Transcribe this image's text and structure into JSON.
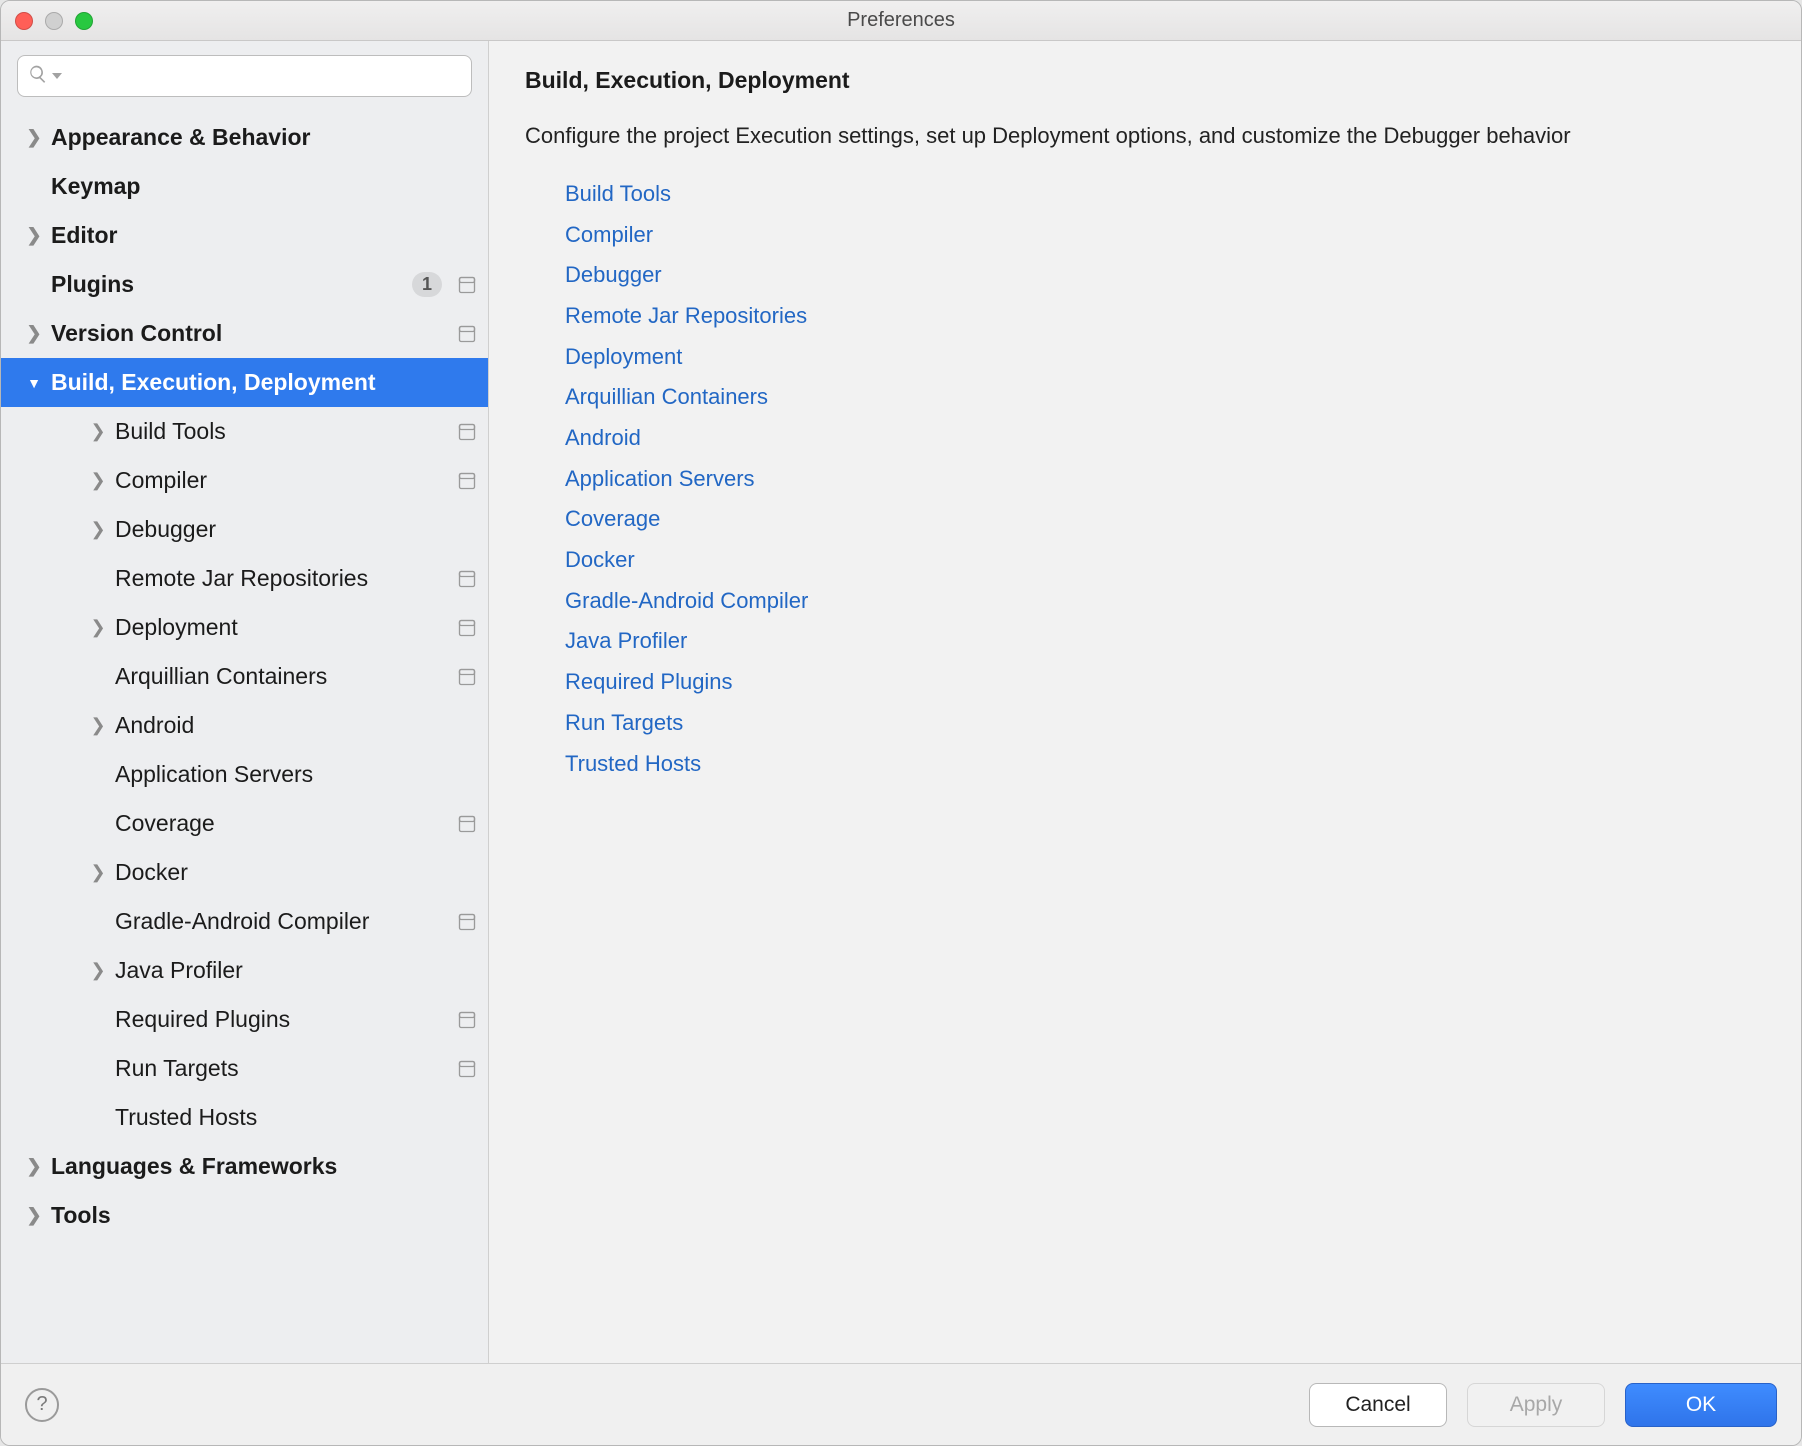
{
  "window": {
    "title": "Preferences"
  },
  "sidebar": {
    "search_placeholder": "",
    "items": [
      {
        "label": "Appearance & Behavior",
        "arrow": "right",
        "top": true
      },
      {
        "label": "Keymap",
        "arrow": "",
        "top": true
      },
      {
        "label": "Editor",
        "arrow": "right",
        "top": true
      },
      {
        "label": "Plugins",
        "arrow": "",
        "top": true,
        "badge": "1",
        "proj": true
      },
      {
        "label": "Version Control",
        "arrow": "right",
        "top": true,
        "proj": true
      },
      {
        "label": "Build, Execution, Deployment",
        "arrow": "down",
        "top": true,
        "selected": true
      },
      {
        "label": "Build Tools",
        "arrow": "right",
        "child": true,
        "proj": true
      },
      {
        "label": "Compiler",
        "arrow": "right",
        "child": true,
        "proj": true
      },
      {
        "label": "Debugger",
        "arrow": "right",
        "child": true
      },
      {
        "label": "Remote Jar Repositories",
        "arrow": "",
        "child": true,
        "proj": true
      },
      {
        "label": "Deployment",
        "arrow": "right",
        "child": true,
        "proj": true
      },
      {
        "label": "Arquillian Containers",
        "arrow": "",
        "child": true,
        "proj": true
      },
      {
        "label": "Android",
        "arrow": "right",
        "child": true
      },
      {
        "label": "Application Servers",
        "arrow": "",
        "child": true
      },
      {
        "label": "Coverage",
        "arrow": "",
        "child": true,
        "proj": true
      },
      {
        "label": "Docker",
        "arrow": "right",
        "child": true
      },
      {
        "label": "Gradle-Android Compiler",
        "arrow": "",
        "child": true,
        "proj": true
      },
      {
        "label": "Java Profiler",
        "arrow": "right",
        "child": true
      },
      {
        "label": "Required Plugins",
        "arrow": "",
        "child": true,
        "proj": true
      },
      {
        "label": "Run Targets",
        "arrow": "",
        "child": true,
        "proj": true
      },
      {
        "label": "Trusted Hosts",
        "arrow": "",
        "child": true
      },
      {
        "label": "Languages & Frameworks",
        "arrow": "right",
        "top": true
      },
      {
        "label": "Tools",
        "arrow": "right",
        "top": true
      }
    ]
  },
  "main": {
    "title": "Build, Execution, Deployment",
    "description": "Configure the project Execution settings, set up Deployment options, and customize the Debugger behavior",
    "links": [
      "Build Tools",
      "Compiler",
      "Debugger",
      "Remote Jar Repositories",
      "Deployment",
      "Arquillian Containers",
      "Android",
      "Application Servers",
      "Coverage",
      "Docker",
      "Gradle-Android Compiler",
      "Java Profiler",
      "Required Plugins",
      "Run Targets",
      "Trusted Hosts"
    ]
  },
  "footer": {
    "cancel": "Cancel",
    "apply": "Apply",
    "ok": "OK"
  }
}
